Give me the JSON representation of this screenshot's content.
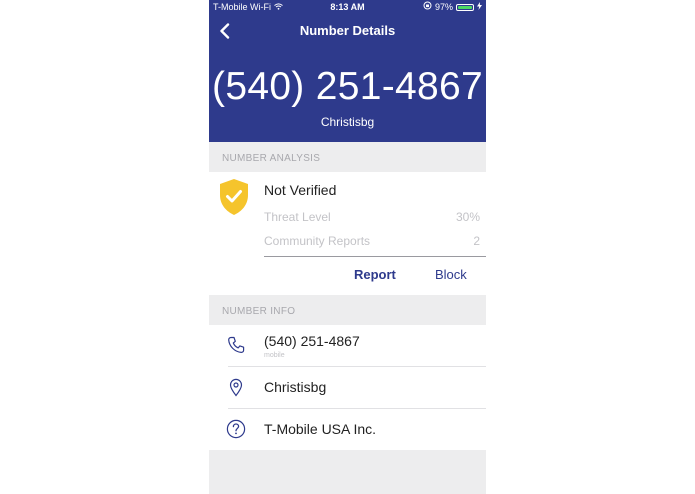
{
  "status_bar": {
    "carrier": "T-Mobile Wi-Fi",
    "time": "8:13 AM",
    "battery": "97%",
    "battery_level": 0.97
  },
  "nav": {
    "title": "Number Details",
    "back_icon": "chevron-left-icon"
  },
  "hero": {
    "number": "(540) 251-4867",
    "name": "Christisbg"
  },
  "analysis": {
    "section_label": "NUMBER ANALYSIS",
    "status": "Not Verified",
    "status_icon": "shield-check-icon",
    "threat_label": "Threat Level",
    "threat_value": "30%",
    "reports_label": "Community Reports",
    "reports_value": "2",
    "report_button": "Report",
    "block_button": "Block"
  },
  "info": {
    "section_label": "NUMBER INFO",
    "rows": [
      {
        "icon": "phone-icon",
        "text": "(540) 251-4867",
        "sub": "mobile"
      },
      {
        "icon": "location-pin-icon",
        "text": "Christisbg"
      },
      {
        "icon": "question-icon",
        "text": "T-Mobile USA Inc."
      }
    ]
  },
  "colors": {
    "brand": "#2e3a8c",
    "shield": "#f5c42c",
    "battery": "#4cd964"
  }
}
